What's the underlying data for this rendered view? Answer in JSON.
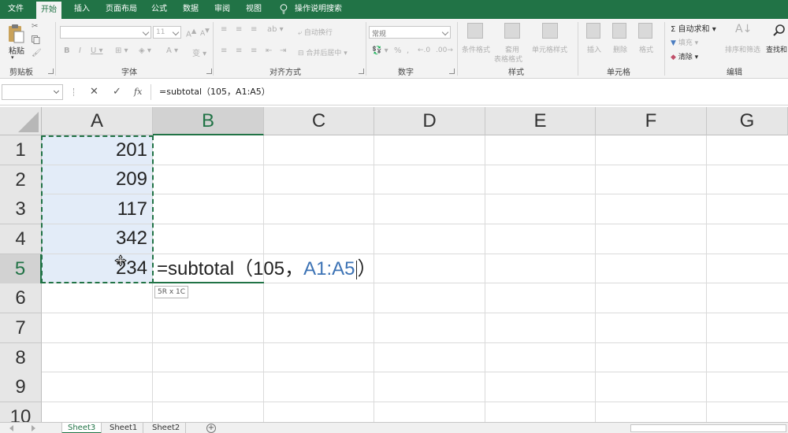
{
  "menu_tabs": [
    "文件",
    "开始",
    "插入",
    "页面布局",
    "公式",
    "数据",
    "审阅",
    "视图"
  ],
  "menu_tell_me": "操作说明搜索",
  "ribbon": {
    "clipboard": {
      "paste": "粘贴",
      "group": "剪贴板"
    },
    "font": {
      "name_value": "",
      "size_value": "11",
      "group": "字体"
    },
    "align": {
      "wrap": "自动换行",
      "merge": "合并后居中",
      "group": "对齐方式"
    },
    "number": {
      "format_value": "常规",
      "group": "数字",
      "percent": "%"
    },
    "styles": {
      "cond": "条件格式",
      "table1": "套用",
      "table2": "表格格式",
      "cell_style": "单元格样式",
      "group": "样式"
    },
    "cells": {
      "insert": "插入",
      "delete": "删除",
      "format": "格式",
      "group": "单元格"
    },
    "editing": {
      "autosum": "自动求和",
      "fill": "填充",
      "clear": "清除",
      "sort": "排序和筛选",
      "find": "查找和",
      "group": "编辑"
    }
  },
  "formula_bar": {
    "name_box": "",
    "cancel": "✕",
    "confirm": "✓",
    "fx": "fx",
    "content": "=subtotal（105，A1:A5）"
  },
  "columns": [
    "A",
    "B",
    "C",
    "D",
    "E",
    "F",
    "G"
  ],
  "rows": [
    "1",
    "2",
    "3",
    "4",
    "5",
    "6",
    "7",
    "8",
    "9",
    "10"
  ],
  "cells_a": [
    "201",
    "209",
    "117",
    "342",
    "234"
  ],
  "edit": {
    "prefix": "=subtotal（105，",
    "ref": "A1:A5",
    "suffix": "）"
  },
  "range_tooltip": "5R x 1C",
  "sheets": [
    "Sheet3",
    "Sheet1",
    "Sheet2"
  ],
  "colors": {
    "accent": "#217346",
    "selection": "#e3ecf8",
    "ref_blue": "#3d73b5"
  }
}
